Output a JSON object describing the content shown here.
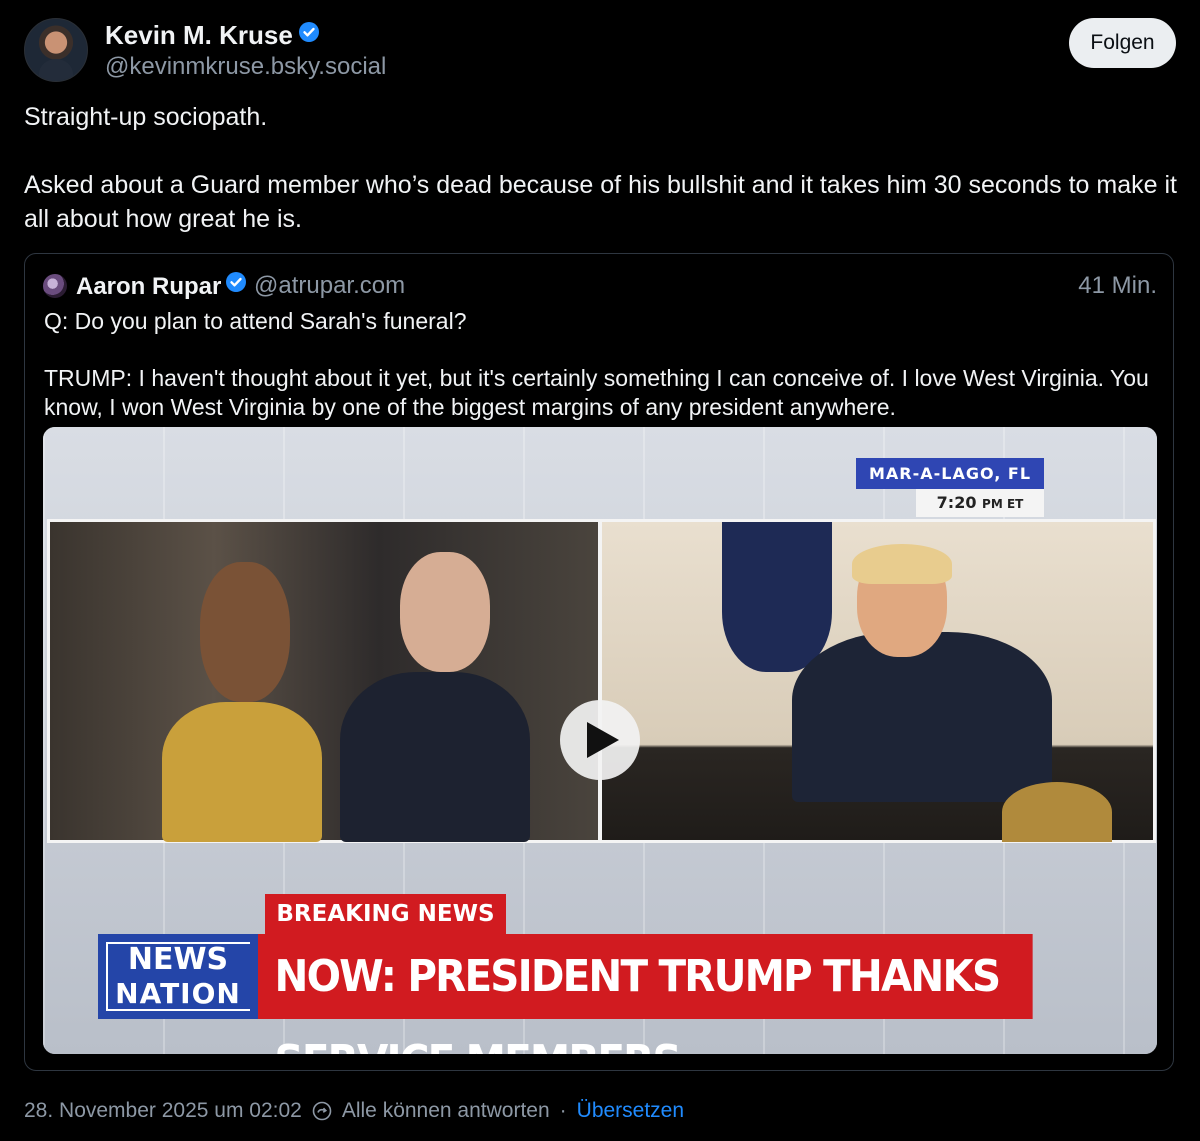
{
  "author": {
    "name": "Kevin M. Kruse",
    "handle": "@kevinmkruse.bsky.social",
    "follow_label": "Folgen"
  },
  "post": {
    "paragraphs": [
      "Straight-up sociopath.",
      "Asked about a Guard member who’s dead because of his bullshit and it takes him 30 seconds to make it all about how great he is."
    ]
  },
  "quote": {
    "name": "Aaron Rupar",
    "handle": "@atrupar.com",
    "time": "41 Min.",
    "paragraphs": [
      "Q: Do you plan to attend Sarah's funeral?",
      "TRUMP: I haven't thought about it yet, but it's certainly something I can conceive of. I love West Virginia. You know, I won West Virginia by one of the biggest margins of any president anywhere."
    ],
    "video": {
      "location": "MAR-A-LAGO, FL",
      "time_main": "7:20",
      "time_suffix": "PM ET",
      "breaking": "BREAKING NEWS",
      "logo_line1": "NEWS",
      "logo_line2": "NATION",
      "headline": "NOW: PRESIDENT TRUMP THANKS SERVICE MEMBERS"
    }
  },
  "footer": {
    "date": "28. November 2025 um 02:02",
    "reply_setting": "Alle können antworten",
    "separator": "·",
    "translate": "Übersetzen"
  },
  "colors": {
    "background": "#000000",
    "accent": "#208bfe",
    "muted": "#8d98a5",
    "news_red": "#d11b20",
    "news_blue": "#2445a8"
  }
}
